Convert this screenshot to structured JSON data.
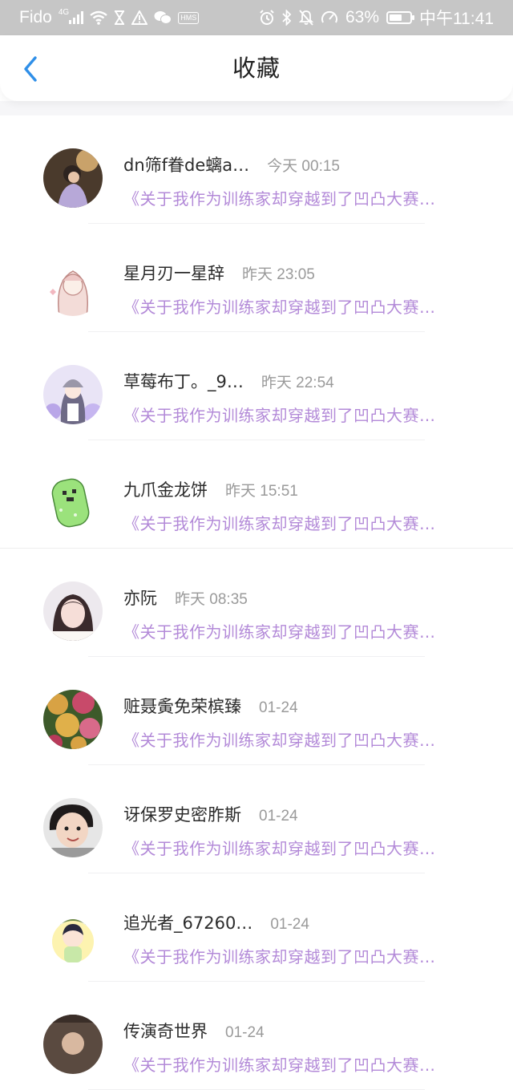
{
  "status_bar": {
    "carrier": "Fido",
    "network": "4G",
    "hms_badge": "HMS",
    "battery": "63%",
    "battery_level": 0.63,
    "time": "中午11:41"
  },
  "header": {
    "title": "收藏",
    "back_icon": "chevron-left-icon"
  },
  "colors": {
    "accent_blue": "#2f8fe8",
    "link_purple": "#b38ad8",
    "status_bar_bg": "#c6c6c6"
  },
  "favorites": [
    {
      "name": "dn筛f眷de螭a…",
      "time": "今天 00:15",
      "link": "《关于我作为训练家却穿越到了凹凸大赛…"
    },
    {
      "name": "星月刃一星辞",
      "time": "昨天 23:05",
      "link": "《关于我作为训练家却穿越到了凹凸大赛…"
    },
    {
      "name": "草莓布丁。_9…",
      "time": "昨天 22:54",
      "link": "《关于我作为训练家却穿越到了凹凸大赛…"
    },
    {
      "name": "九爪金龙饼",
      "time": "昨天 15:51",
      "link": "《关于我作为训练家却穿越到了凹凸大赛…"
    },
    {
      "name": "亦阮",
      "time": "昨天 08:35",
      "link": "《关于我作为训练家却穿越到了凹凸大赛…"
    },
    {
      "name": "赃聂夤免荣槟臻",
      "time": "01-24",
      "link": "《关于我作为训练家却穿越到了凹凸大赛…"
    },
    {
      "name": "讶保罗史密胙斯",
      "time": "01-24",
      "link": "《关于我作为训练家却穿越到了凹凸大赛…"
    },
    {
      "name": "追光者_67260…",
      "time": "01-24",
      "link": "《关于我作为训练家却穿越到了凹凸大赛…"
    },
    {
      "name": "传演奇世界",
      "time": "01-24",
      "link": "《关于我作为训练家却穿越到了凹凸大赛…"
    }
  ]
}
